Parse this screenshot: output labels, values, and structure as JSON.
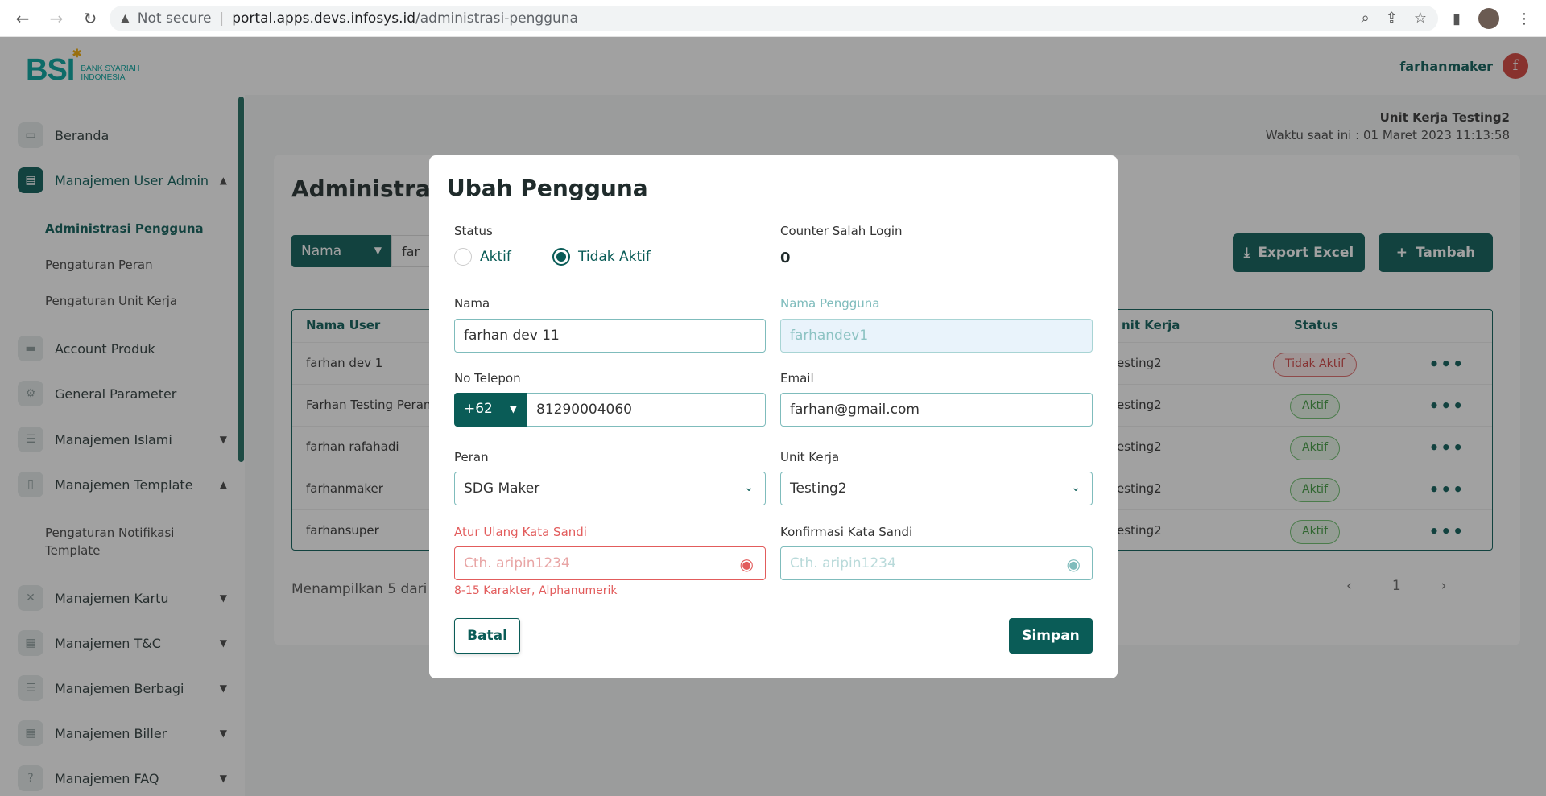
{
  "browser": {
    "security_label": "Not secure",
    "url_host": "portal.apps.devs.infosys.id",
    "url_path": "/administrasi-pengguna"
  },
  "header": {
    "logo_text": "BSI",
    "logo_sub_1": "BANK SYARIAH",
    "logo_sub_2": "INDONESIA",
    "username": "farhanmaker",
    "avatar_letter": "f"
  },
  "sidebar": {
    "items": [
      {
        "label": "Beranda"
      },
      {
        "label": "Manajemen User Admin"
      },
      {
        "label": "Account Produk"
      },
      {
        "label": "General Parameter"
      },
      {
        "label": "Manajemen Islami"
      },
      {
        "label": "Manajemen Template"
      },
      {
        "label": "Manajemen Kartu"
      },
      {
        "label": "Manajemen T&C"
      },
      {
        "label": "Manajemen Berbagi"
      },
      {
        "label": "Manajemen Biller"
      },
      {
        "label": "Manajemen FAQ"
      }
    ],
    "sub_user_admin": [
      "Administrasi Pengguna",
      "Pengaturan Peran",
      "Pengaturan Unit Kerja"
    ],
    "sub_template_line1": "Pengaturan Notifikasi",
    "sub_template_line2": "Template"
  },
  "main": {
    "unit_kerja": "Unit Kerja Testing2",
    "waktu": "Waktu saat ini : 01 Maret 2023 11:13:58",
    "page_title": "Administrasi",
    "filter_select": "Nama",
    "filter_value": "far",
    "export_label": "Export Excel",
    "add_label": "Tambah",
    "columns": {
      "nama_user": "Nama User",
      "unit_kerja": "nit Kerja",
      "status": "Status"
    },
    "rows": [
      {
        "name": "farhan dev 1",
        "unit": "esting2",
        "status": "Tidak Aktif"
      },
      {
        "name": "Farhan Testing Peran",
        "unit": "esting2",
        "status": "Aktif"
      },
      {
        "name": "farhan rafahadi",
        "unit": "esting2",
        "status": "Aktif"
      },
      {
        "name": "farhanmaker",
        "unit": "esting2",
        "status": "Aktif"
      },
      {
        "name": "farhansuper",
        "unit": "esting2",
        "status": "Aktif"
      }
    ],
    "showing": "Menampilkan 5 dari",
    "page_number": "1"
  },
  "modal": {
    "title": "Ubah Pengguna",
    "status_label": "Status",
    "status_aktif": "Aktif",
    "status_tidak_aktif": "Tidak Aktif",
    "status_selected": "Tidak Aktif",
    "counter_label": "Counter Salah Login",
    "counter_value": "0",
    "nama_label": "Nama",
    "nama_value": "farhan dev 11",
    "nama_pengguna_label": "Nama Pengguna",
    "nama_pengguna_value": "farhandev1",
    "telepon_label": "No Telepon",
    "country_code": "+62",
    "telepon_value": "81290004060",
    "email_label": "Email",
    "email_value": "farhan@gmail.com",
    "peran_label": "Peran",
    "peran_value": "SDG Maker",
    "unit_label": "Unit Kerja",
    "unit_value": "Testing2",
    "reset_label": "Atur Ulang Kata Sandi",
    "reset_placeholder": "Cth. aripin1234",
    "reset_helper": "8-15 Karakter, Alphanumerik",
    "confirm_label": "Konfirmasi Kata Sandi",
    "confirm_placeholder": "Cth. aripin1234",
    "cancel_label": "Batal",
    "save_label": "Simpan"
  }
}
